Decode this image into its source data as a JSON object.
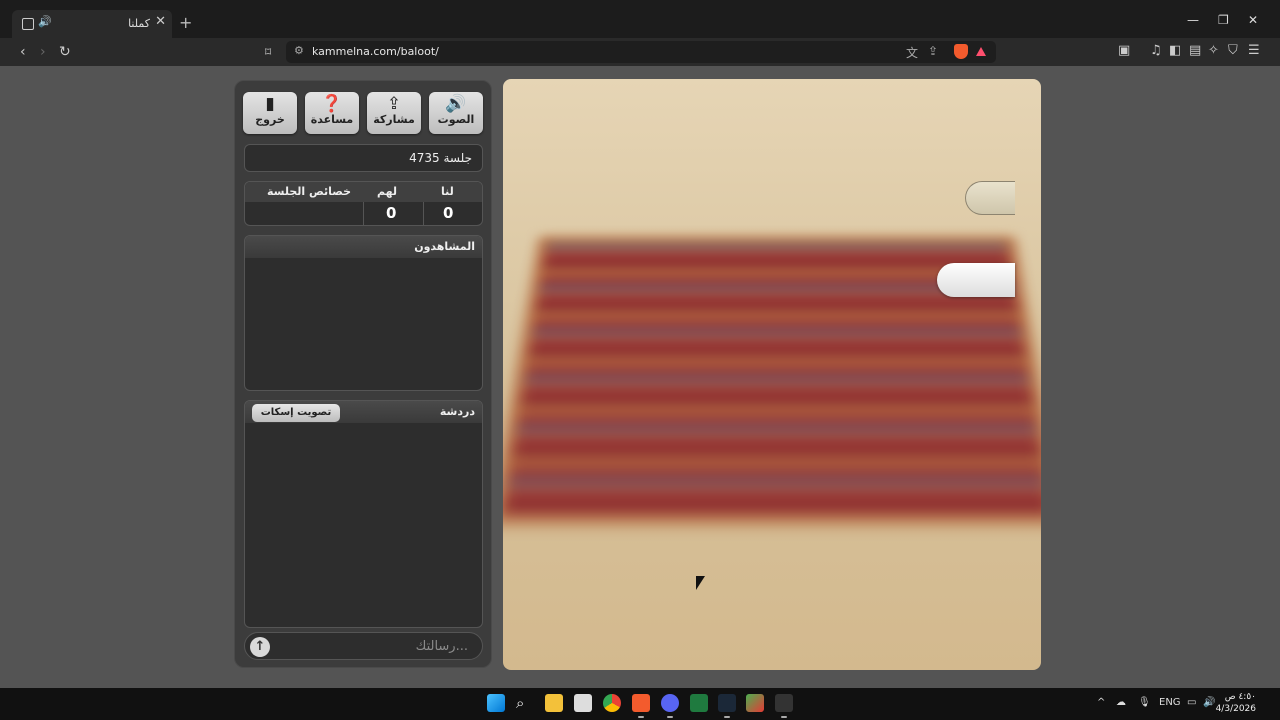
{
  "browser": {
    "tab_title": "كملنا",
    "url": "kammelna.com/baloot/",
    "icons": [
      "speaker-icon",
      "close-icon",
      "plus-icon",
      "back-icon",
      "forward-icon",
      "reload-icon",
      "bookmark-icon",
      "translate-icon",
      "share-icon",
      "brave-shield-icon",
      "brave-rewards-icon",
      "reader-icon",
      "media-icon",
      "sidebar-icon",
      "wallet-icon",
      "leo-icon",
      "vpn-icon",
      "menu-icon"
    ]
  },
  "panel": {
    "buttons": [
      {
        "label": "الصوت",
        "icon": "speaker-icon"
      },
      {
        "label": "مشاركة",
        "icon": "share-icon"
      },
      {
        "label": "مساعدة",
        "icon": "help-icon"
      },
      {
        "label": "خروج",
        "icon": "exit-door-icon"
      }
    ],
    "session": "جلسة 4735",
    "score": {
      "us_label": "لنا",
      "them_label": "لهم",
      "props_label": "خصائص الجلسة",
      "us_value": "0",
      "them_value": "0"
    },
    "watchers_title": "المشاهدون",
    "chat_title": "دردشة",
    "mute_button": "تصويت إسكات",
    "message_placeholder": "رسالتك..."
  },
  "taskbar": {
    "language": "ENG",
    "time": "٤:٥٠ ص",
    "date": "4/3/2026"
  }
}
